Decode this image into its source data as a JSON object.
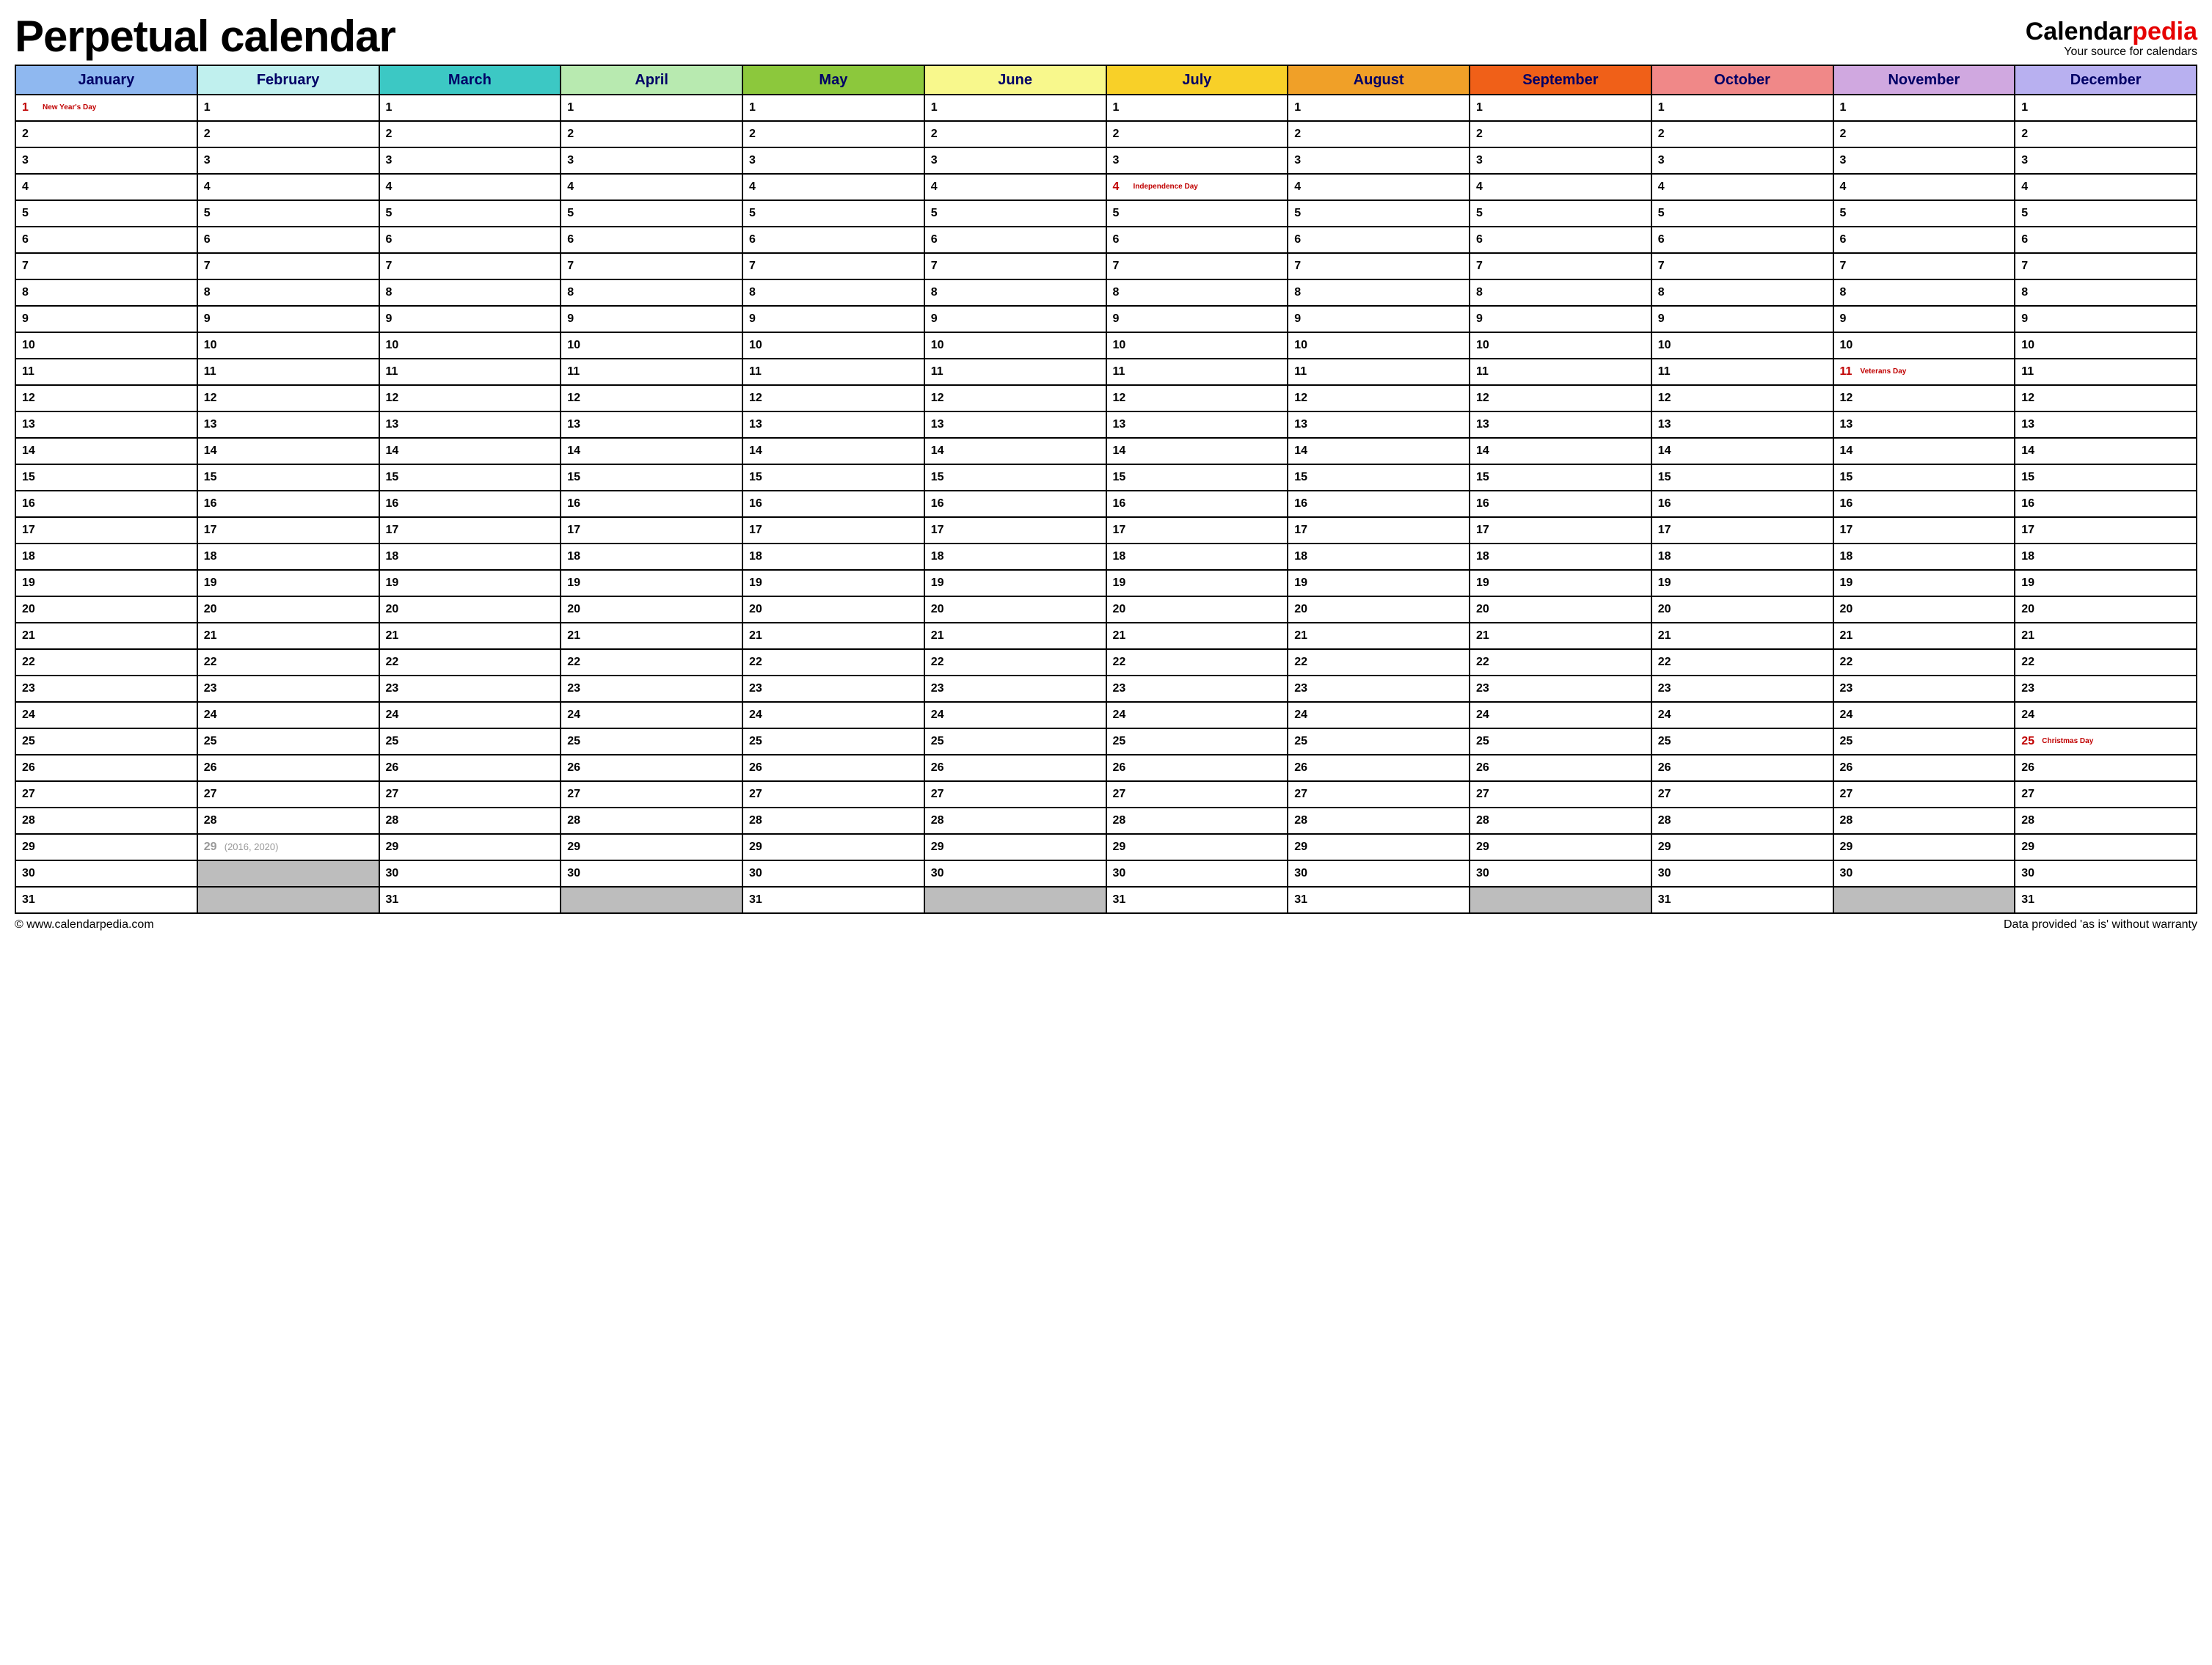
{
  "title": "Perpetual calendar",
  "brand": {
    "part1": "Calendar",
    "part2": "pedia",
    "tagline": "Your source for calendars"
  },
  "footer": {
    "left": "© www.calendarpedia.com",
    "right": "Data provided 'as is' without warranty"
  },
  "months": [
    {
      "name": "January",
      "color": "#8fb8f0",
      "days": 31
    },
    {
      "name": "February",
      "color": "#c0f0ee",
      "days": 29
    },
    {
      "name": "March",
      "color": "#3cc8c4",
      "days": 31
    },
    {
      "name": "April",
      "color": "#b8eab0",
      "days": 30
    },
    {
      "name": "May",
      "color": "#8cc83c",
      "days": 31
    },
    {
      "name": "June",
      "color": "#f8f88c",
      "days": 30
    },
    {
      "name": "July",
      "color": "#f8d028",
      "days": 31
    },
    {
      "name": "August",
      "color": "#f0a028",
      "days": 31
    },
    {
      "name": "September",
      "color": "#f06018",
      "days": 30
    },
    {
      "name": "October",
      "color": "#f08888",
      "days": 31
    },
    {
      "name": "November",
      "color": "#d0a8e0",
      "days": 30
    },
    {
      "name": "December",
      "color": "#b8b0f0",
      "days": 31
    }
  ],
  "max_days": 31,
  "holidays": [
    {
      "month": 0,
      "day": 1,
      "label": "New Year's Day"
    },
    {
      "month": 6,
      "day": 4,
      "label": "Independence Day"
    },
    {
      "month": 10,
      "day": 11,
      "label": "Veterans Day"
    },
    {
      "month": 11,
      "day": 25,
      "label": "Christmas Day"
    }
  ],
  "special_cells": [
    {
      "month": 1,
      "day": 29,
      "faded": true,
      "note": "(2016, 2020)"
    }
  ]
}
